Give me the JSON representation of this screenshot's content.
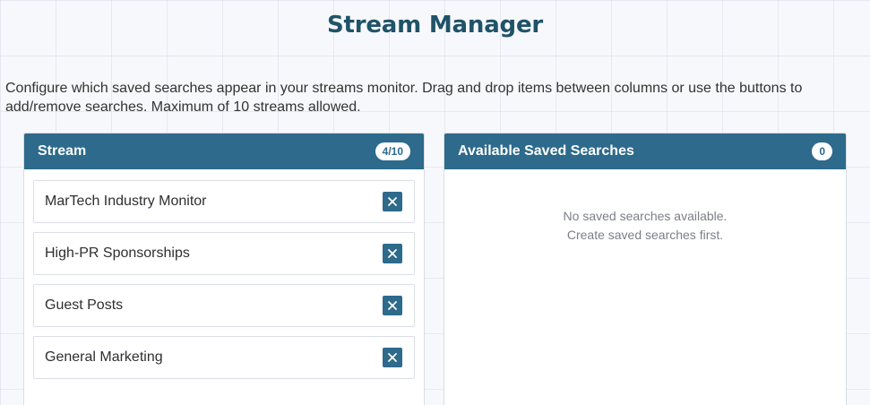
{
  "header": {
    "title": "Stream Manager"
  },
  "description": "Configure which saved searches appear in your streams monitor. Drag and drop items between columns or use the buttons to add/remove searches. Maximum of 10 streams allowed.",
  "stream_panel": {
    "title": "Stream",
    "count": "4/10",
    "items": [
      {
        "label": "MarTech Industry Monitor",
        "remove_icon": "close-icon"
      },
      {
        "label": "High-PR Sponsorships",
        "remove_icon": "close-icon"
      },
      {
        "label": "Guest Posts",
        "remove_icon": "close-icon"
      },
      {
        "label": "General Marketing",
        "remove_icon": "close-icon"
      }
    ]
  },
  "available_panel": {
    "title": "Available Saved Searches",
    "count": "0",
    "empty_line1": "No saved searches available.",
    "empty_line2": "Create saved searches first."
  },
  "colors": {
    "accent": "#2d6a8b",
    "title": "#1f5368",
    "background": "#f7f8fb"
  }
}
